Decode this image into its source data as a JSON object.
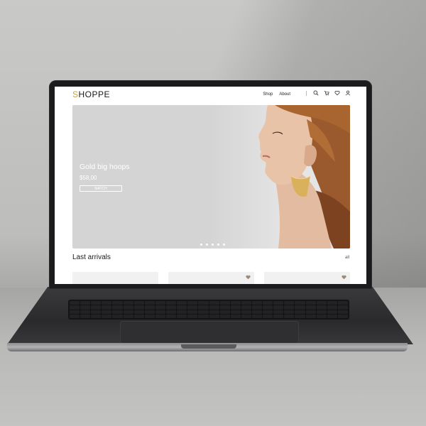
{
  "site": {
    "logo_first": "S",
    "logo_rest": "HOPPE",
    "nav": [
      "Shop",
      "About"
    ],
    "icons": [
      "search-icon",
      "cart-icon",
      "heart-icon",
      "user-icon"
    ]
  },
  "hero": {
    "title": "Gold big hoops",
    "price": "$58,00",
    "button": "WATCH",
    "slides_total": 5
  },
  "section": {
    "title": "Last arrivals",
    "link": "all"
  },
  "products": [
    {
      "favorite_icon": false
    },
    {
      "favorite_icon": true
    },
    {
      "favorite_icon": true
    }
  ],
  "colors": {
    "accent": "#c9a24a",
    "hero_bg": "#d4d4d4"
  }
}
